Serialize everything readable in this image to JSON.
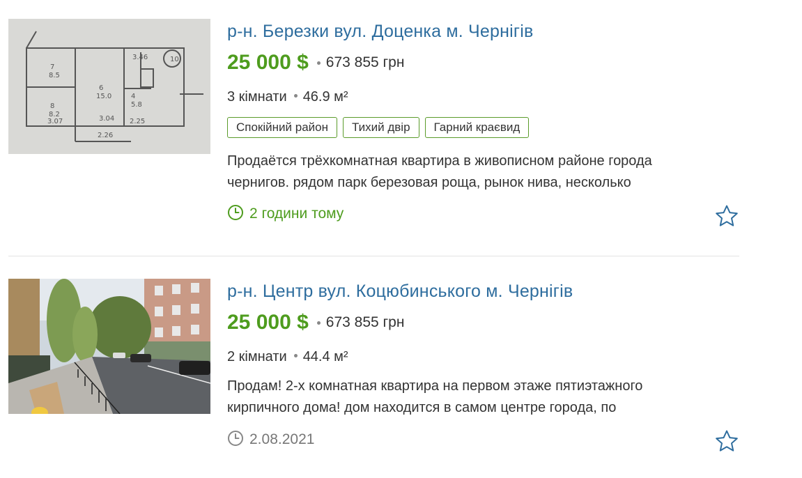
{
  "listings": [
    {
      "title": "р-н. Березки вул. Доценка м. Чернігів",
      "price_usd": "25 000 $",
      "price_uah": "673 855 грн",
      "rooms": "3 кімнати",
      "area": "46.9 м²",
      "tags": [
        "Спокійний район",
        "Тихий двір",
        "Гарний краєвид"
      ],
      "description_lines": [
        "Продаётся трёхкомнатная квартира в живописном районе города",
        "чернигов. рядом парк березовая роща, рынок нива, несколько"
      ],
      "time": "2 години тому",
      "icons": {
        "photo": "floor-plan-photo",
        "time": "clock-icon",
        "favorite": "star-outline-icon"
      }
    },
    {
      "title": "р-н. Центр вул. Коцюбинського м. Чернігів",
      "price_usd": "25 000 $",
      "price_uah": "673 855 грн",
      "rooms": "2 кімнати",
      "area": "44.4 м²",
      "description_lines": [
        "Продам! 2-х комнатная квартира на первом этаже пятиэтажного",
        "кирпичного дома! дом находится в самом центре города, по"
      ],
      "time": "2.08.2021",
      "icons": {
        "photo": "street-photo",
        "time": "clock-icon",
        "favorite": "star-outline-icon"
      }
    }
  ],
  "colors": {
    "title_link": "#2e6d9e",
    "price_green": "#4e9c1e",
    "tag_border": "#5a9b2a",
    "time_recent": "#4e9c1e",
    "time_old": "#777777",
    "star": "#2e6d9e"
  }
}
